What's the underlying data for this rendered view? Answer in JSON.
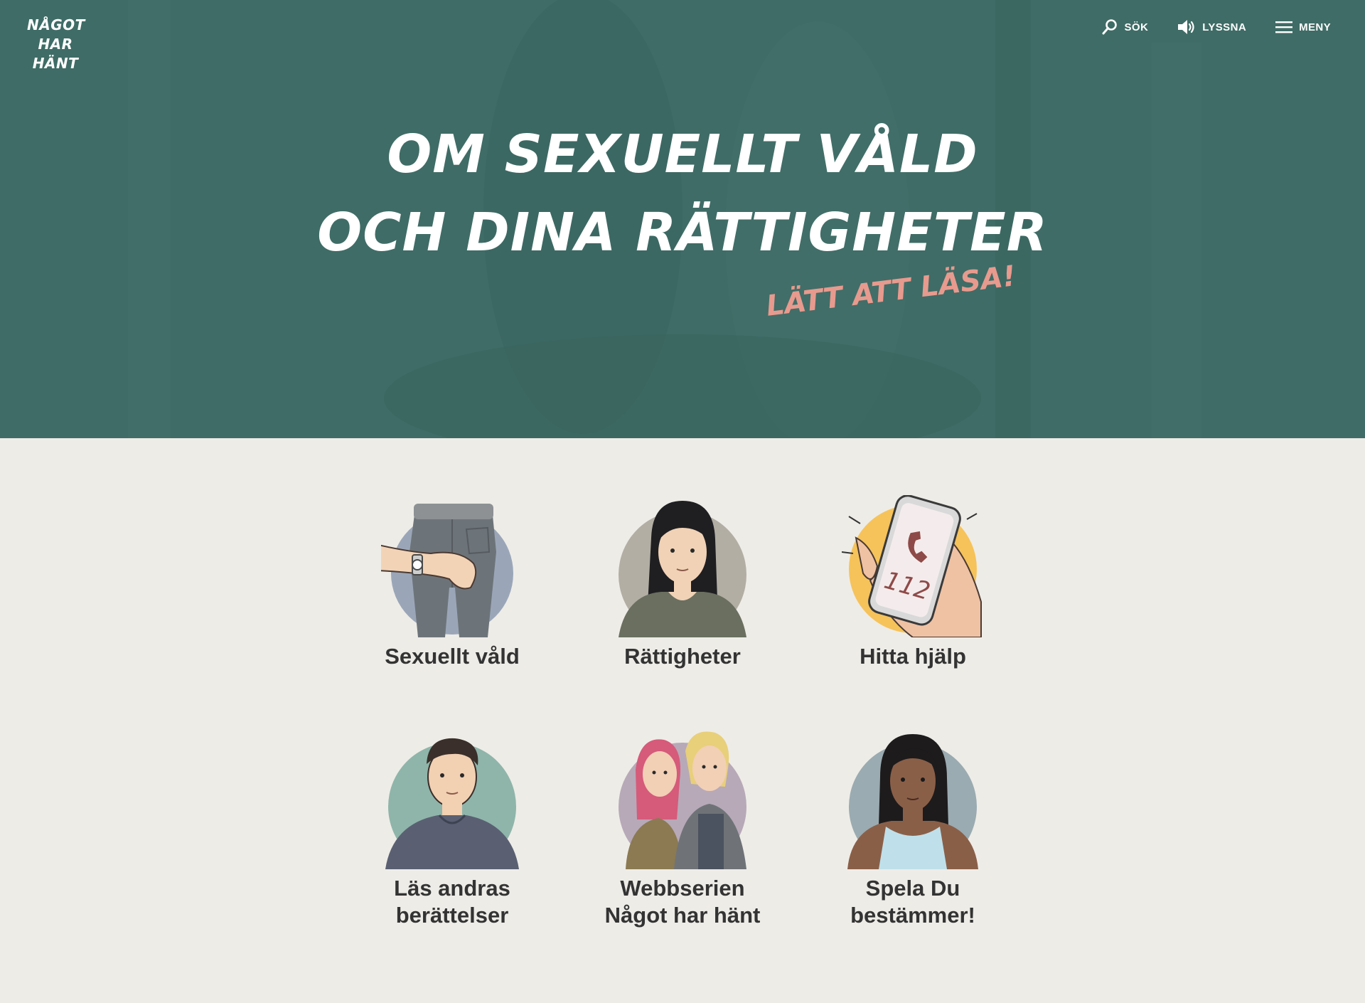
{
  "logo": {
    "line1": "NÅGOT",
    "line2": "HAR",
    "line3": "HÄNT"
  },
  "nav": {
    "search_label": "SÖK",
    "listen_label": "LYSSNA",
    "menu_label": "MENY"
  },
  "hero": {
    "title_line1": "OM SEXUELLT VÅLD",
    "title_line2": "OCH DINA RÄTTIGHETER",
    "subtitle": "LÄTT ATT LÄSA!"
  },
  "cards": [
    {
      "label": "Sexuellt våld",
      "icon": "jeans-hand-illustration",
      "bg_color": "#9aa6b8"
    },
    {
      "label": "Rättigheter",
      "icon": "girl-portrait-illustration",
      "bg_color": "#b2aea4"
    },
    {
      "label": "Hitta hjälp",
      "icon": "phone-112-illustration",
      "bg_color": "#f6c35a",
      "phone_text": "112"
    },
    {
      "label_line1": "Läs andras",
      "label_line2": "berättelser",
      "icon": "boy-portrait-illustration",
      "bg_color": "#8fb5aa"
    },
    {
      "label_line1": "Webbserien",
      "label_line2": "Något har hänt",
      "icon": "two-friends-illustration",
      "bg_color": "#b7a9b8"
    },
    {
      "label_line1": "Spela Du",
      "label_line2": "bestämmer!",
      "icon": "woman-portrait-illustration",
      "bg_color": "#9aabb1"
    }
  ],
  "colors": {
    "hero_bg": "#3f6c66",
    "accent_pink": "#e89a8e",
    "page_bg": "#eeece7",
    "text_dark": "#333333"
  }
}
